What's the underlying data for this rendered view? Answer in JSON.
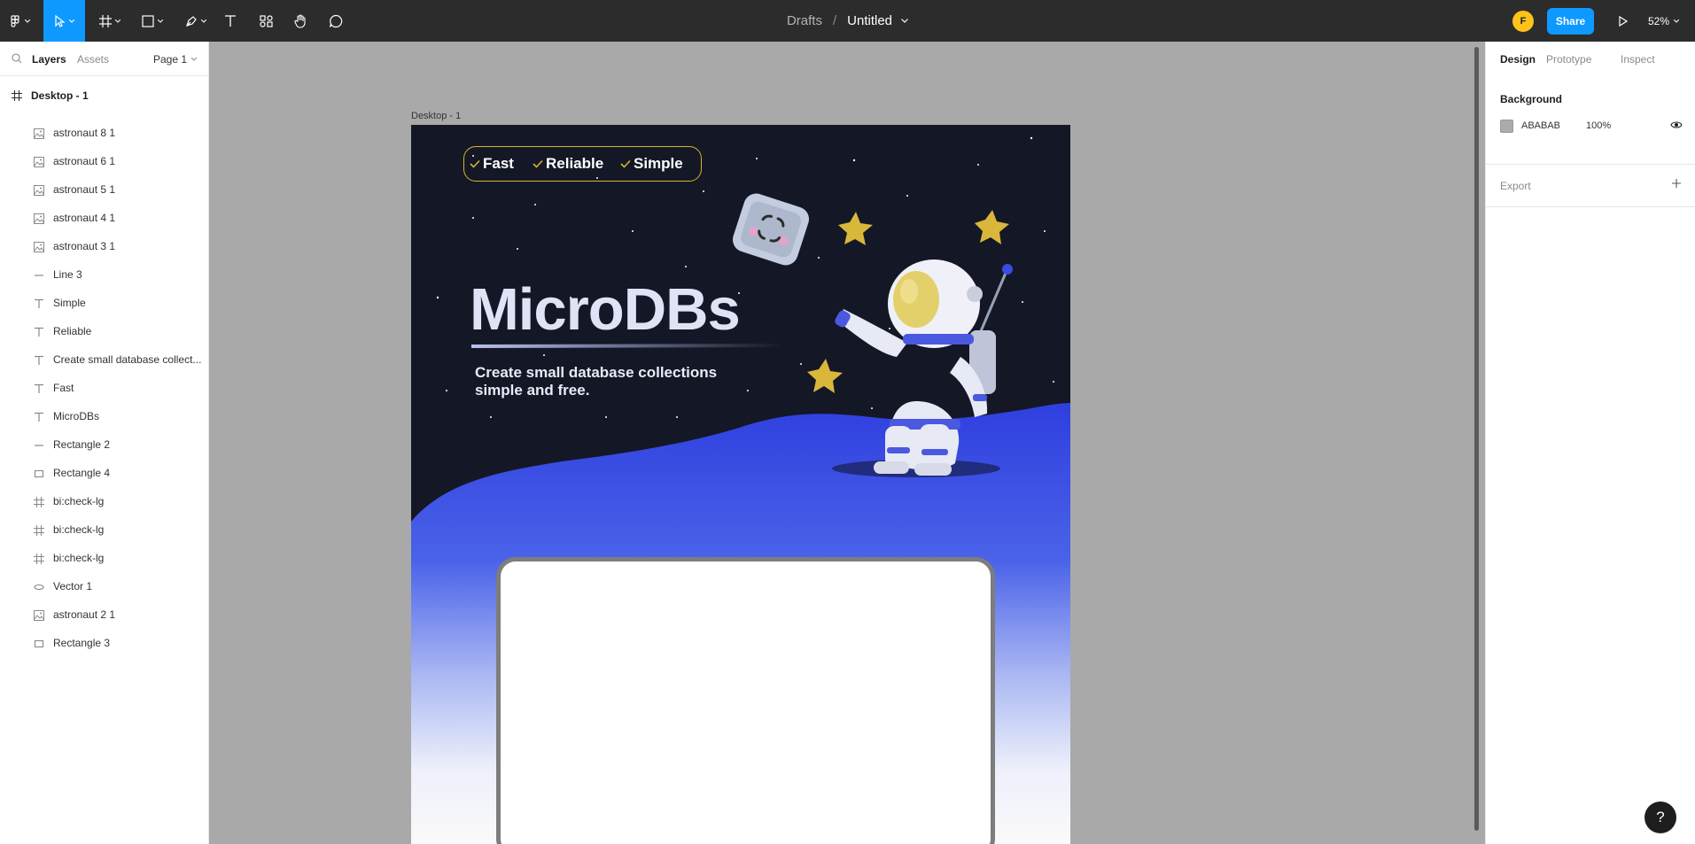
{
  "toolbar": {
    "breadcrumb_parent": "Drafts",
    "breadcrumb_separator": "/",
    "file_title": "Untitled",
    "avatar_initial": "F",
    "share_label": "Share",
    "zoom_label": "52%",
    "tools": [
      "main-menu",
      "move",
      "frame",
      "shape",
      "pen",
      "text",
      "resources",
      "hand",
      "comment"
    ],
    "active_tool": "move"
  },
  "left_panel": {
    "tabs": {
      "layers": "Layers",
      "assets": "Assets"
    },
    "page_selector": "Page 1",
    "top_frame": "Desktop - 1",
    "layers": [
      {
        "name": "astronaut 8 1",
        "icon": "image-icon"
      },
      {
        "name": "astronaut 6 1",
        "icon": "image-icon"
      },
      {
        "name": "astronaut 5 1",
        "icon": "image-icon"
      },
      {
        "name": "astronaut 4 1",
        "icon": "image-icon"
      },
      {
        "name": "astronaut 3 1",
        "icon": "image-icon"
      },
      {
        "name": "Line 3",
        "icon": "line-icon"
      },
      {
        "name": "Simple",
        "icon": "text-icon"
      },
      {
        "name": "Reliable",
        "icon": "text-icon"
      },
      {
        "name": "Create small database collect...",
        "icon": "text-icon"
      },
      {
        "name": "Fast",
        "icon": "text-icon"
      },
      {
        "name": "MicroDBs",
        "icon": "text-icon"
      },
      {
        "name": "Rectangle 2",
        "icon": "line-icon"
      },
      {
        "name": "Rectangle 4",
        "icon": "rectangle-icon"
      },
      {
        "name": "bi:check-lg",
        "icon": "frame-icon"
      },
      {
        "name": "bi:check-lg",
        "icon": "frame-icon"
      },
      {
        "name": "bi:check-lg",
        "icon": "frame-icon"
      },
      {
        "name": "Vector 1",
        "icon": "vector-icon"
      },
      {
        "name": "astronaut 2 1",
        "icon": "image-icon"
      },
      {
        "name": "Rectangle 3",
        "icon": "rectangle-icon"
      }
    ]
  },
  "canvas": {
    "frame_label": "Desktop - 1",
    "design": {
      "features": [
        "Fast",
        "Reliable",
        "Simple"
      ],
      "headline": "MicroDBs",
      "subline": "Create small database collections simple and free."
    }
  },
  "right_panel": {
    "tabs": {
      "design": "Design",
      "prototype": "Prototype",
      "inspect": "Inspect"
    },
    "background_title": "Background",
    "background_hex": "ABABAB",
    "background_opacity": "100%",
    "export_title": "Export"
  },
  "help_label": "?",
  "colors": {
    "toolbar_bg": "#2c2c2c",
    "accent": "#0d99ff",
    "canvas_bg": "#a9a9a9",
    "design_sky": "#141726",
    "design_blue": "#3447e0",
    "pill_border": "#d9b32c"
  }
}
